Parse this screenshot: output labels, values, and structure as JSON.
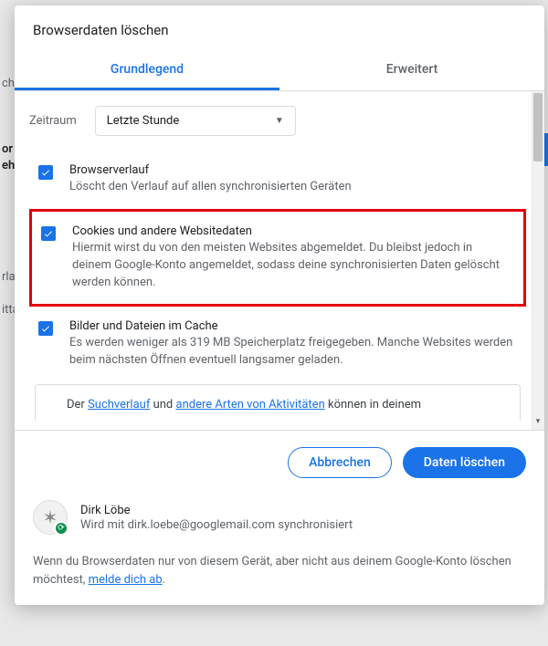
{
  "bg": {
    "t1": "ch",
    "t2": "or",
    "t3": "eh",
    "t4": "rla",
    "t5": "itta"
  },
  "dialog": {
    "title": "Browserdaten löschen",
    "tabs": {
      "basic": "Grundlegend",
      "advanced": "Erweitert"
    },
    "timerange": {
      "label": "Zeitraum",
      "value": "Letzte Stunde"
    },
    "options": {
      "history": {
        "title": "Browserverlauf",
        "desc": "Löscht den Verlauf auf allen synchronisierten Geräten"
      },
      "cookies": {
        "title": "Cookies und andere Websitedaten",
        "desc": "Hiermit wirst du von den meisten Websites abgemeldet. Du bleibst jedoch in deinem Google-Konto angemeldet, sodass deine synchronisierten Daten gelöscht werden können."
      },
      "cache": {
        "title": "Bilder und Dateien im Cache",
        "desc": "Es werden weniger als 319 MB Speicherplatz freigegeben. Manche Websites werden beim nächsten Öffnen eventuell langsamer geladen."
      }
    },
    "infobox": {
      "pre": "Der ",
      "link1": "Suchverlauf",
      "mid": " und ",
      "link2": "andere Arten von Aktivitäten",
      "post": " können in deinem"
    },
    "buttons": {
      "cancel": "Abbrechen",
      "confirm": "Daten löschen"
    },
    "account": {
      "name": "Dirk Löbe",
      "sync": "Wird mit dirk.loebe@googlemail.com synchronisiert"
    },
    "footnote": {
      "pre": "Wenn du Browserdaten nur von diesem Gerät, aber nicht aus deinem Google-Konto löschen möchtest, ",
      "link": "melde dich ab",
      "post": "."
    }
  }
}
